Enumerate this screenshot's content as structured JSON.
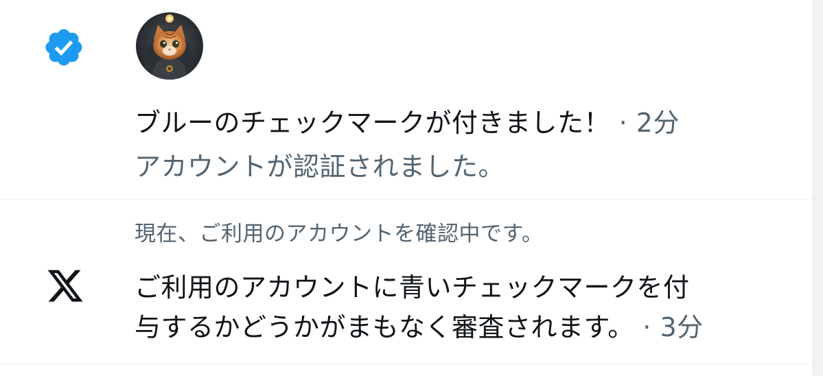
{
  "notifications": [
    {
      "icon": "verified-badge-icon",
      "icon_color": "#1d9bf0",
      "title": "ブルーのチェックマークが付きました！",
      "separator": "·",
      "time": "2分",
      "subtitle": "アカウントが認証されました。"
    },
    {
      "icon": "x-logo-icon",
      "icon_color": "#0f1419",
      "context": "現在、ご利用のアカウントを確認中です。",
      "body_line_1": "ご利用のアカウントに青いチェックマークを付",
      "body_line_2": "与するかどうかがまもなく審査されます。",
      "separator": "·",
      "time": "3分"
    }
  ],
  "colors": {
    "primary_text": "#0f1419",
    "secondary_text": "#536471",
    "verified_blue": "#1d9bf0",
    "divider": "#eff3f4"
  }
}
